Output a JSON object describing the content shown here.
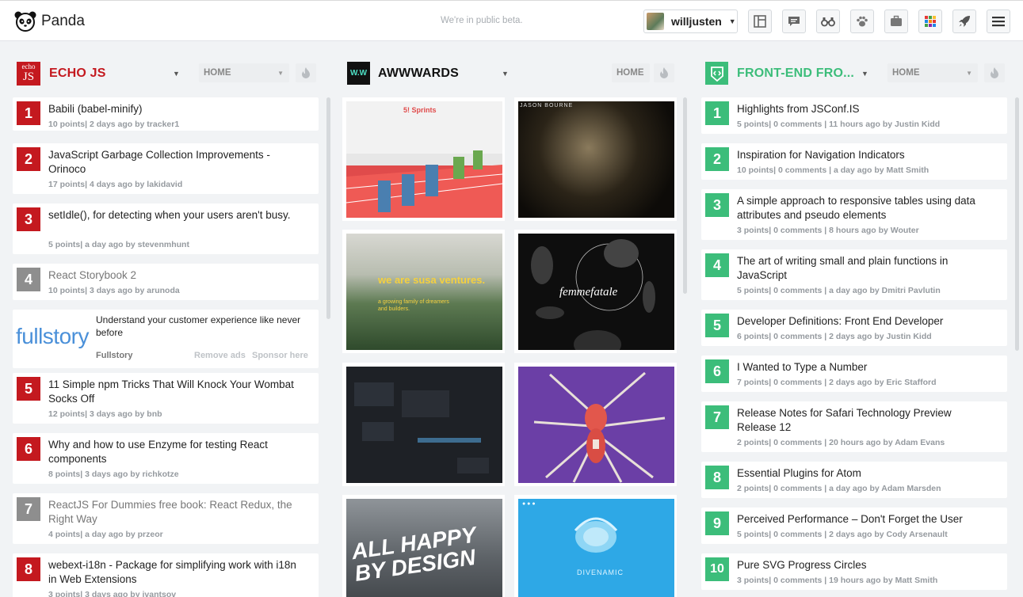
{
  "app": {
    "name": "Panda",
    "beta_text": "We're in public beta.",
    "username": "willjusten"
  },
  "colors": {
    "echojs": "#c4191f",
    "awwwards": "#111111",
    "frontend": "#3cbd7a",
    "dim": "#8e8e8e"
  },
  "toolbar_icons": [
    "layout-icon",
    "chat-icon",
    "binoculars-icon",
    "paw-icon",
    "briefcase-icon",
    "color-grid-icon",
    "rocket-icon",
    "hamburger-menu-icon"
  ],
  "columns": {
    "echojs": {
      "title": "ECHO JS",
      "logo_lines": [
        "echo",
        "JS"
      ],
      "filter": "HOME",
      "items": [
        {
          "rank": "1",
          "title": "Babili (babel-minify)",
          "meta": "10 points| 2 days ago by tracker1",
          "dim": false
        },
        {
          "rank": "2",
          "title": "JavaScript Garbage Collection Improvements - Orinoco",
          "meta": "17 points| 4 days ago by lakidavid",
          "dim": false
        },
        {
          "rank": "3",
          "title": "setIdle(), for detecting when your users aren't busy.",
          "meta": "5 points| a day ago by stevenmhunt",
          "dim": false
        },
        {
          "rank": "4",
          "title": "React Storybook 2",
          "meta": "10 points| 3 days ago by arunoda",
          "dim": true
        },
        {
          "rank": "5",
          "title": "11 Simple npm Tricks That Will Knock Your Wombat Socks Off",
          "meta": "12 points| 3 days ago by bnb",
          "dim": false
        },
        {
          "rank": "6",
          "title": "Why and how to use Enzyme for testing React components",
          "meta": "8 points| 3 days ago by richkotze",
          "dim": false
        },
        {
          "rank": "7",
          "title": "ReactJS For Dummies free book: React Redux, the Right Way",
          "meta": "4 points| a day ago by przeor",
          "dim": true
        },
        {
          "rank": "8",
          "title": "webext-i18n - Package for simplifying work with i18n in Web Extensions",
          "meta": "3 points| 3 days ago by ivantsov",
          "dim": false
        }
      ],
      "ad": {
        "logo": "fullstory",
        "text": "Understand your customer experience like never before",
        "source": "Fullstory",
        "remove": "Remove ads",
        "sponsor": "Sponsor here"
      }
    },
    "awwwards": {
      "title": "AWWWARDS",
      "logo": "W.W",
      "filter": "HOME",
      "tiles": [
        {
          "caption": "5! Sprints",
          "tag": "track-render"
        },
        {
          "caption": "JASON BOURNE",
          "tag": "city-night"
        },
        {
          "caption": "we are susa ventures.",
          "sub": "a growing family of dreamers and builders.",
          "tag": "forest"
        },
        {
          "caption": "femmefatale",
          "tag": "sculptures"
        },
        {
          "caption": "",
          "tag": "dark-grid"
        },
        {
          "caption": "",
          "tag": "spider"
        },
        {
          "caption": "ALL HAPPY BY DESIGN",
          "tag": "store"
        },
        {
          "caption": "DIVENAMIC",
          "tag": "speaker"
        }
      ]
    },
    "frontend": {
      "title": "FRONT-END FRO...",
      "filter": "HOME",
      "items": [
        {
          "rank": "1",
          "title": "Highlights from JSConf.IS",
          "meta": "5 points| 0 comments | 11 hours ago by Justin Kidd"
        },
        {
          "rank": "2",
          "title": "Inspiration for Navigation Indicators",
          "meta": "10 points| 0 comments | a day ago by Matt Smith"
        },
        {
          "rank": "3",
          "title": "A simple approach to responsive tables using data attributes and pseudo elements",
          "meta": "3 points| 0 comments | 8 hours ago by Wouter"
        },
        {
          "rank": "4",
          "title": "The art of writing small and plain functions in JavaScript",
          "meta": "5 points| 0 comments | a day ago by Dmitri Pavlutin"
        },
        {
          "rank": "5",
          "title": "Developer Definitions: Front End Developer",
          "meta": "6 points| 0 comments | 2 days ago by Justin Kidd"
        },
        {
          "rank": "6",
          "title": "I Wanted to Type a Number",
          "meta": "7 points| 0 comments | 2 days ago by Eric Stafford"
        },
        {
          "rank": "7",
          "title": "Release Notes for Safari Technology Preview Release 12",
          "meta": "2 points| 0 comments | 20 hours ago by Adam Evans"
        },
        {
          "rank": "8",
          "title": "Essential Plugins for Atom",
          "meta": "2 points| 0 comments | a day ago by Adam Marsden"
        },
        {
          "rank": "9",
          "title": "Perceived Performance – Don't Forget the User",
          "meta": "5 points| 0 comments | 2 days ago by Cody Arsenault"
        },
        {
          "rank": "10",
          "title": "Pure SVG Progress Circles",
          "meta": "3 points| 0 comments | 19 hours ago by Matt Smith"
        }
      ]
    }
  }
}
